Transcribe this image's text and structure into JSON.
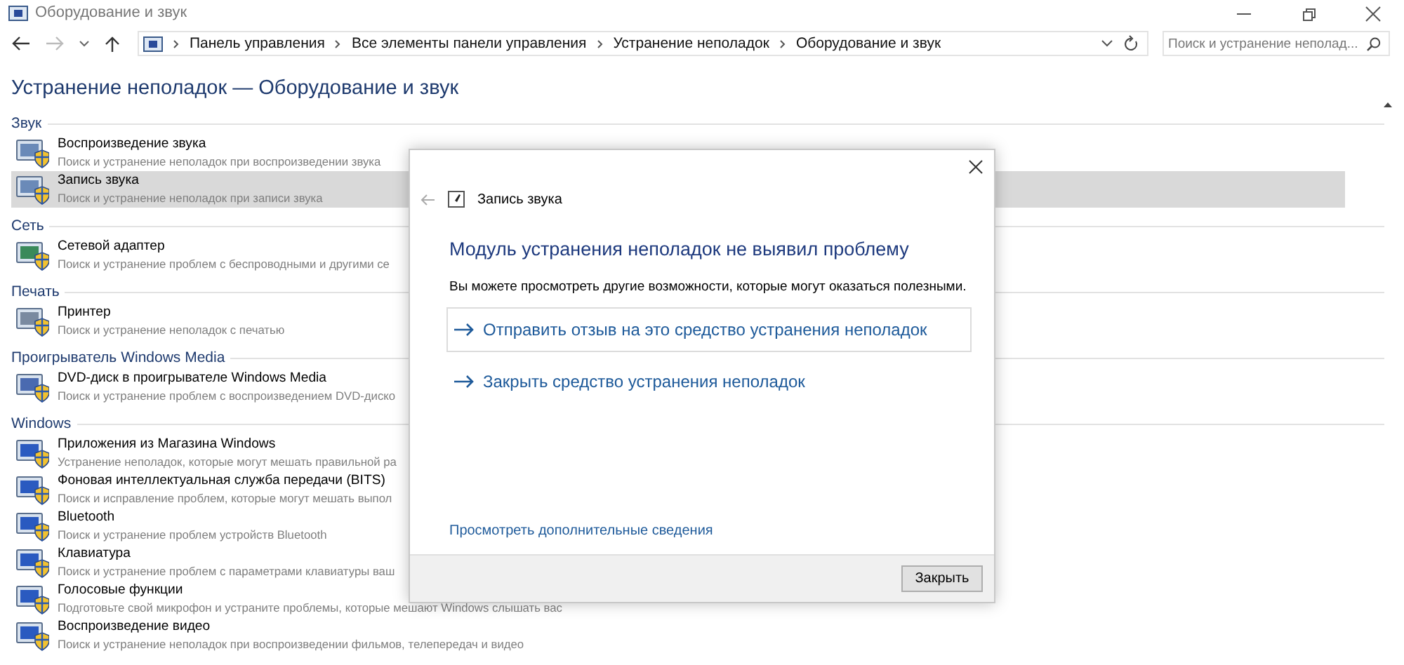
{
  "window": {
    "title": "Оборудование и звук"
  },
  "address": {
    "crumbs": [
      "Панель управления",
      "Все элементы панели управления",
      "Устранение неполадок",
      "Оборудование и звук"
    ]
  },
  "search": {
    "placeholder": "Поиск и устранение неполад..."
  },
  "heading": "Устранение неполадок — Оборудование и звук",
  "sections": [
    {
      "title": "Звук",
      "items": [
        {
          "title": "Воспроизведение звука",
          "description": "Поиск и устранение неполадок при воспроизведении звука",
          "selected": false
        },
        {
          "title": "Запись звука",
          "description": "Поиск и устранение неполадок при записи звука",
          "selected": true
        }
      ]
    },
    {
      "title": "Сеть",
      "items": [
        {
          "title": "Сетевой адаптер",
          "description": "Поиск и устранение проблем с беспроводными и другими се",
          "selected": false
        }
      ]
    },
    {
      "title": "Печать",
      "items": [
        {
          "title": "Принтер",
          "description": "Поиск и устранение неполадок с печатью",
          "selected": false
        }
      ]
    },
    {
      "title": "Проигрыватель Windows Media",
      "items": [
        {
          "title": "DVD-диск в проигрывателе Windows Media",
          "description": "Поиск и устранение проблем с воспроизведением DVD-диско",
          "selected": false
        }
      ]
    },
    {
      "title": "Windows",
      "items": [
        {
          "title": "Приложения из Магазина Windows",
          "description": "Устранение неполадок, которые могут мешать правильной ра",
          "selected": false
        },
        {
          "title": "Фоновая интеллектуальная служба передачи (BITS)",
          "description": "Поиск и исправление проблем, которые могут мешать выпол",
          "selected": false
        },
        {
          "title": "Bluetooth",
          "description": "Поиск и устранение проблем устройств Bluetooth",
          "selected": false
        },
        {
          "title": "Клавиатура",
          "description": "Поиск и устранение проблем с параметрами клавиатуры ваш",
          "selected": false
        },
        {
          "title": "Голосовые функции",
          "description": "Подготовьте свой микрофон и устраните проблемы, которые мешают Windows слышать вас",
          "selected": false
        },
        {
          "title": "Воспроизведение видео",
          "description": "Поиск и устранение неполадок при воспроизведении фильмов, телепередач и видео",
          "selected": false
        }
      ]
    }
  ],
  "dialog": {
    "title": "Запись звука",
    "heading": "Модуль устранения неполадок не выявил проблему",
    "text": "Вы можете просмотреть другие возможности, которые могут оказаться полезными.",
    "options": [
      {
        "label": "Отправить отзыв на это средство устранения неполадок",
        "selected": true
      },
      {
        "label": "Закрыть средство устранения неполадок",
        "selected": false
      }
    ],
    "details_link": "Просмотреть дополнительные сведения",
    "close_button": "Закрыть"
  }
}
